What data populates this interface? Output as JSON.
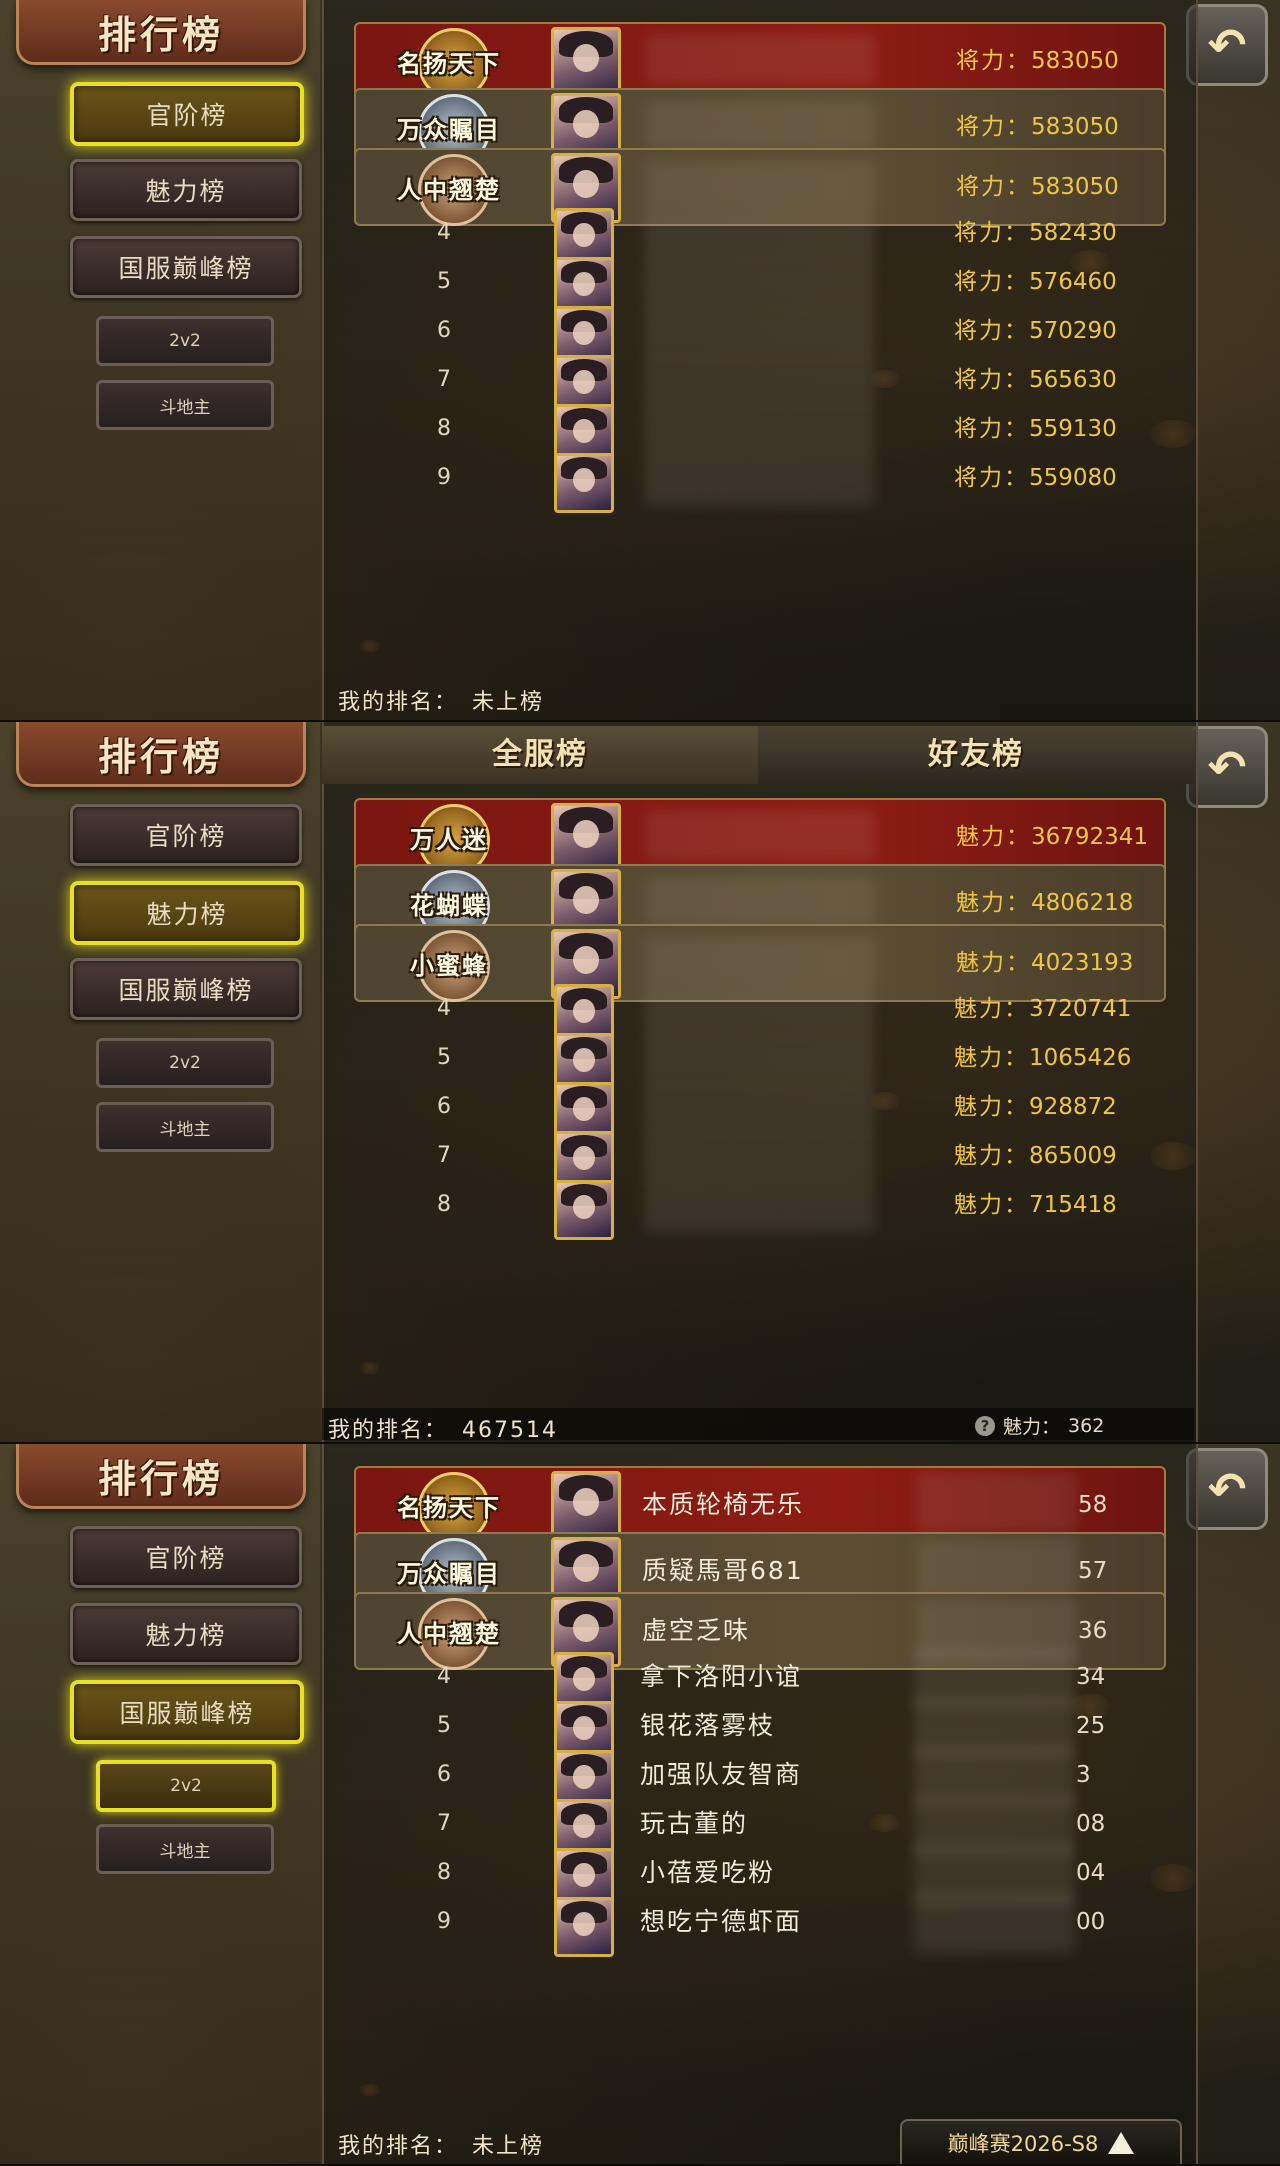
{
  "common": {
    "title": "排行榜",
    "nav": [
      "官阶榜",
      "魅力榜",
      "国服巅峰榜"
    ],
    "sub": [
      "2v2",
      "斗地主"
    ],
    "back_glyph": "↶",
    "medals": [
      "名扬天下",
      "万众瞩目",
      "人中翘楚"
    ],
    "my_rank_label": "我的排名："
  },
  "panels": [
    {
      "active_nav": 0,
      "value_label": "将力：",
      "my_rank_value": "未上榜",
      "rows": [
        {
          "rank": "1",
          "value": "583050"
        },
        {
          "rank": "2",
          "value": "583050"
        },
        {
          "rank": "3",
          "value": "583050"
        },
        {
          "rank": "4",
          "value": "582430"
        },
        {
          "rank": "5",
          "value": "576460"
        },
        {
          "rank": "6",
          "value": "570290"
        },
        {
          "rank": "7",
          "value": "565630"
        },
        {
          "rank": "8",
          "value": "559130"
        },
        {
          "rank": "9",
          "value": "559080"
        }
      ]
    },
    {
      "active_nav": 1,
      "tabs": [
        "全服榜",
        "好友榜"
      ],
      "medals": [
        "万人迷",
        "花蝴蝶",
        "小蜜蜂"
      ],
      "value_label": "魅力：",
      "my_rank_value": "467514",
      "my_charm_label": "魅力：",
      "my_charm_value": "362",
      "rows": [
        {
          "rank": "1",
          "value": "36792341"
        },
        {
          "rank": "2",
          "value": "4806218"
        },
        {
          "rank": "3",
          "value": "4023193"
        },
        {
          "rank": "4",
          "value": "3720741"
        },
        {
          "rank": "5",
          "value": "1065426"
        },
        {
          "rank": "6",
          "value": "928872"
        },
        {
          "rank": "7",
          "value": "865009"
        },
        {
          "rank": "8",
          "value": "715418"
        }
      ]
    },
    {
      "active_nav": 2,
      "active_sub": 0,
      "my_rank_value": "未上榜",
      "season_label": "巅峰赛2026-S8",
      "rows": [
        {
          "rank": "1",
          "name": "本质轮椅无乐",
          "value_tail": "58"
        },
        {
          "rank": "2",
          "name": "质疑馬哥681",
          "value_tail": "57"
        },
        {
          "rank": "3",
          "name": "虚空乏味",
          "value_tail": "36"
        },
        {
          "rank": "4",
          "name": "拿下洛阳小谊",
          "value_tail": "34"
        },
        {
          "rank": "5",
          "name": "银花落雾枝",
          "value_tail": "25"
        },
        {
          "rank": "6",
          "name": "加强队友智商",
          "value_tail": "3"
        },
        {
          "rank": "7",
          "name": "玩古董的",
          "value_tail": "08"
        },
        {
          "rank": "8",
          "name": "小蓓爱吃粉",
          "value_tail": "04"
        },
        {
          "rank": "9",
          "name": "想吃宁德虾面",
          "value_tail": "00"
        }
      ]
    }
  ],
  "colors": {
    "first_row": "#8e1c14",
    "gold_row": "#5c4e34",
    "value_text": "#f0c640",
    "active_outline": "#e8e020"
  }
}
